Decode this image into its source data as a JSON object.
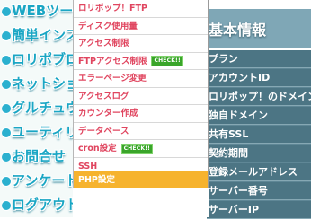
{
  "sidebar": {
    "items": [
      {
        "label": "WEBツール"
      },
      {
        "label": "簡単インストール"
      },
      {
        "label": "ロリポブログ"
      },
      {
        "label": "ネットショップ"
      },
      {
        "label": "グルチュウ"
      },
      {
        "label": "ユーティリティ"
      },
      {
        "label": "お問合せ"
      },
      {
        "label": "アンケート"
      },
      {
        "label": "ログアウト"
      }
    ]
  },
  "info_panel": {
    "title": "基本情報",
    "rows": [
      {
        "label": "プラン"
      },
      {
        "label": "アカウントID"
      },
      {
        "label": "ロリポップ！のドメイン"
      },
      {
        "label": "独自ドメイン"
      },
      {
        "label": "共有SSL"
      },
      {
        "label": "契約期間"
      },
      {
        "label": "登録メールアドレス"
      },
      {
        "label": "サーバー番号"
      },
      {
        "label": "サーバーIP"
      }
    ]
  },
  "dropdown_menu": {
    "items": [
      {
        "label": "ロリポップ！FTP",
        "badge": ""
      },
      {
        "label": "ディスク使用量",
        "badge": ""
      },
      {
        "label": "アクセス制限",
        "badge": ""
      },
      {
        "label": "FTPアクセス制限",
        "badge": "CHECK!!"
      },
      {
        "label": "エラーページ変更",
        "badge": ""
      },
      {
        "label": "アクセスログ",
        "badge": ""
      },
      {
        "label": "カウンター作成",
        "badge": ""
      },
      {
        "label": "データベース",
        "badge": ""
      },
      {
        "label": "cron設定",
        "badge": "CHECK!!"
      },
      {
        "label": "SSH",
        "badge": ""
      },
      {
        "label": "PHP設定",
        "badge": ""
      }
    ],
    "active_item": "PHP設定"
  },
  "colors": {
    "menu_text": "#e0455f",
    "active_bg": "#f6b32e",
    "badge_bg": "#3aa52a",
    "sidebar_text": "#1aa6c4",
    "info_row_bg": "#4c7584"
  }
}
